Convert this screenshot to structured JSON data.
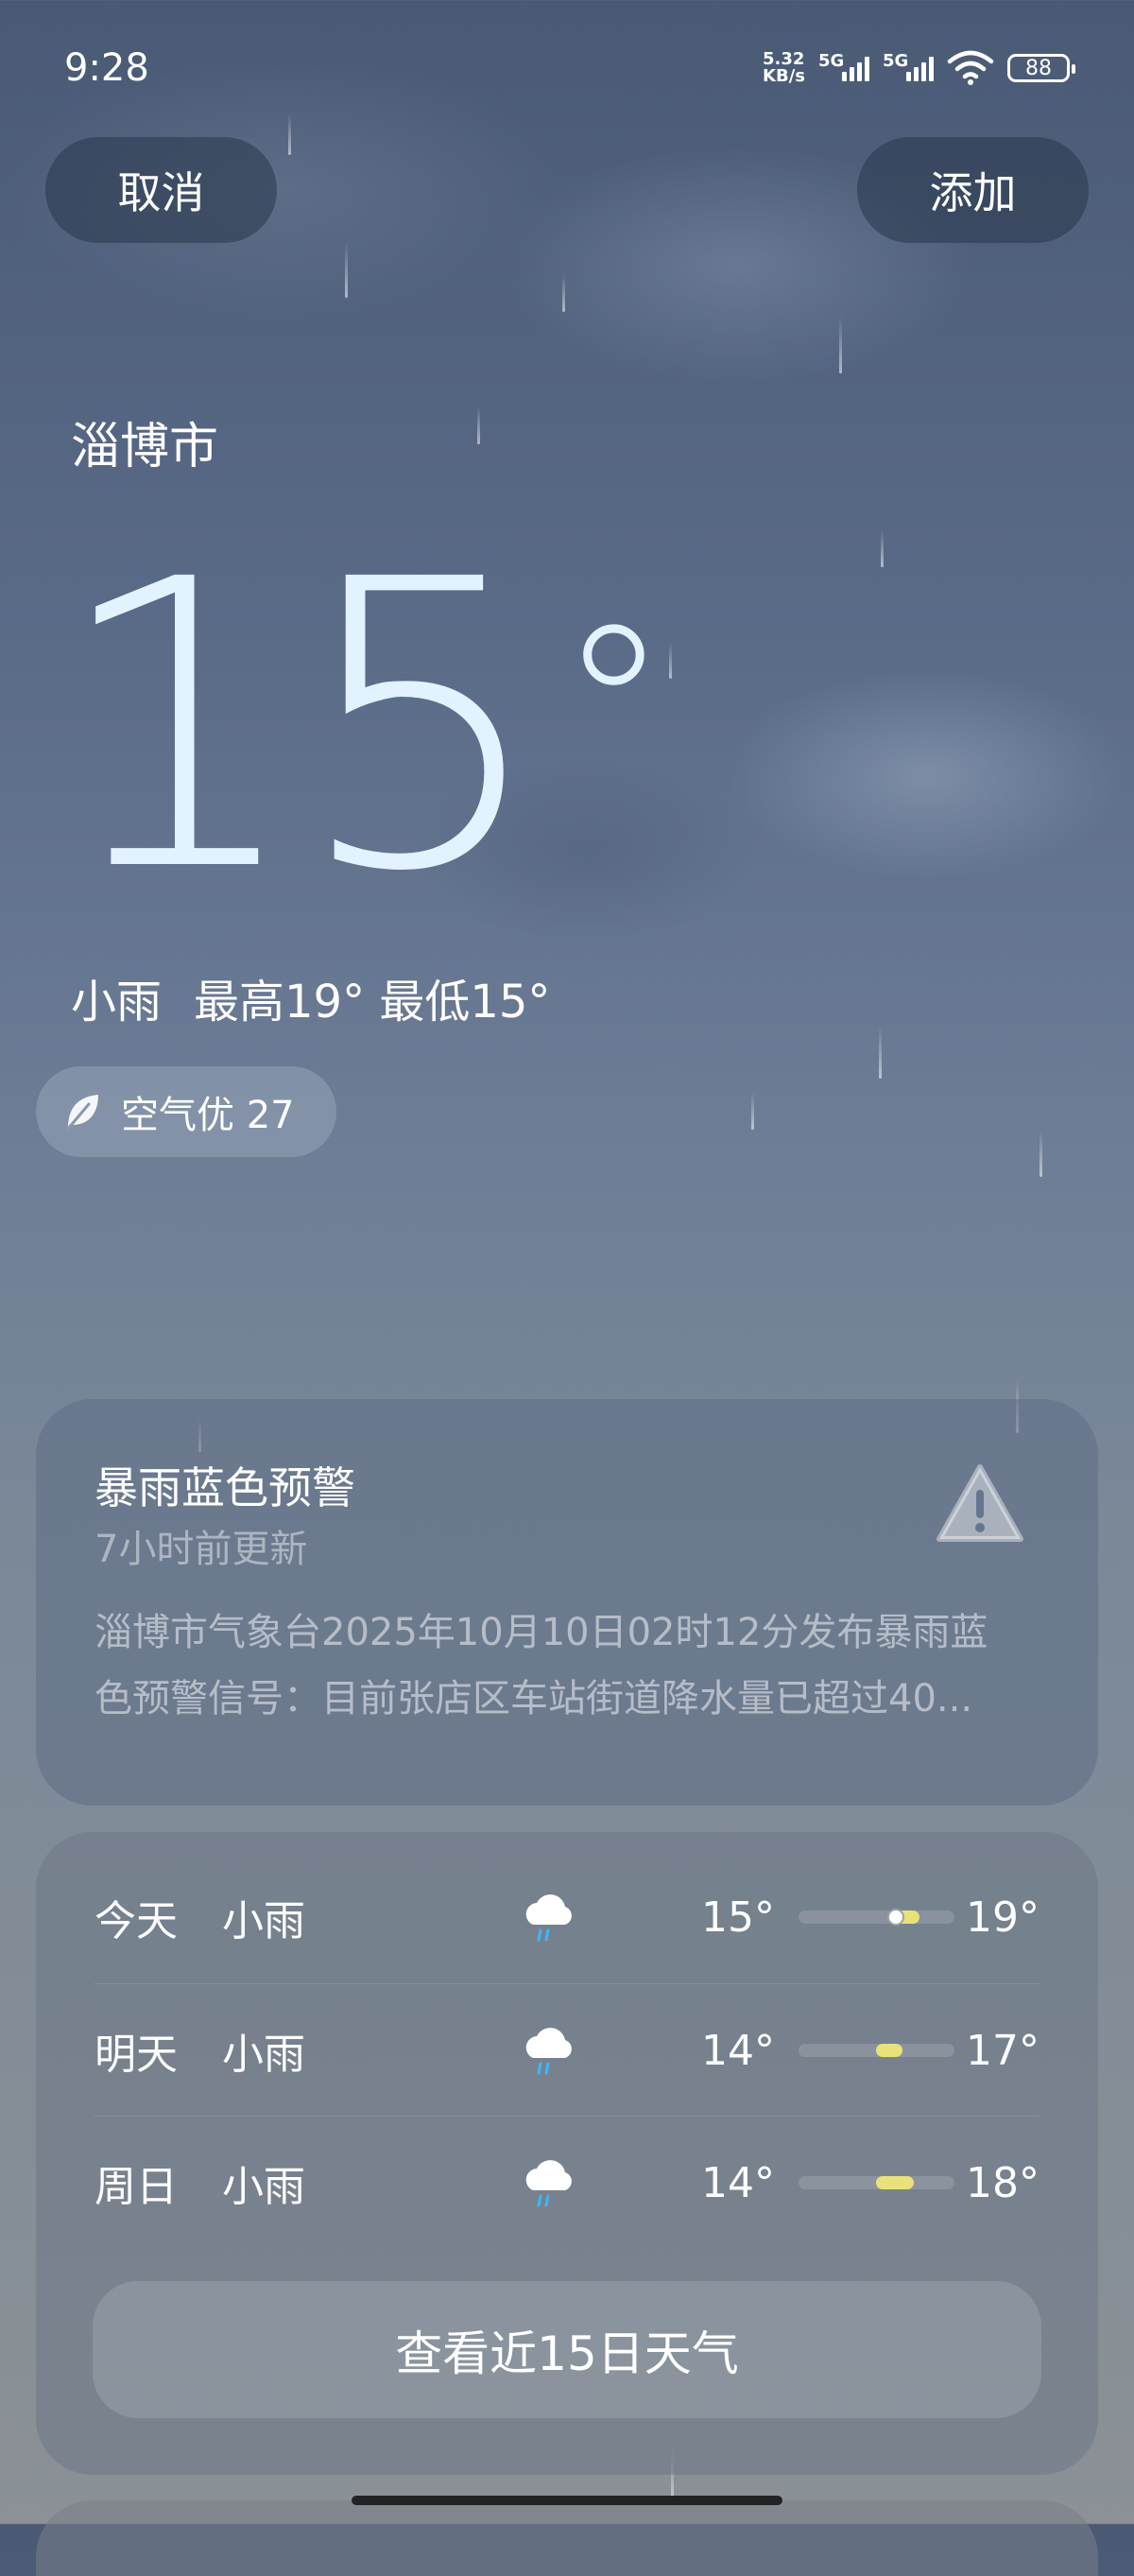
{
  "status_bar": {
    "time": "9:28",
    "net_speed_value": "5.32",
    "net_speed_unit": "KB/s",
    "sim1": "5G",
    "sim2": "5G",
    "battery": "88"
  },
  "header": {
    "cancel_label": "取消",
    "add_label": "添加"
  },
  "current": {
    "city": "淄博市",
    "temp": "15",
    "deg_symbol": "°",
    "condition": "小雨",
    "high_low": "最高19° 最低15°",
    "aqi_label": "空气优 27"
  },
  "alert": {
    "title": "暴雨蓝色预警",
    "updated": "7小时前更新",
    "body_line1": "淄博市气象台2025年10月10日02时12分发布暴雨蓝",
    "body_line2": "色预警信号：目前张店区车站街道降水量已超过40..."
  },
  "forecast": {
    "days": [
      {
        "day": "今天",
        "condition": "小雨",
        "icon": "light-rain-icon",
        "low": "15°",
        "high": "19°",
        "current": true
      },
      {
        "day": "明天",
        "condition": "小雨",
        "icon": "light-rain-icon",
        "low": "14°",
        "high": "17°",
        "current": false
      },
      {
        "day": "周日",
        "condition": "小雨",
        "icon": "light-rain-icon",
        "low": "14°",
        "high": "18°",
        "current": false
      }
    ],
    "more_label": "查看近15日天气"
  },
  "colors": {
    "temp_bar": "#e9e27a",
    "big_temp": "#e3f2ff"
  }
}
